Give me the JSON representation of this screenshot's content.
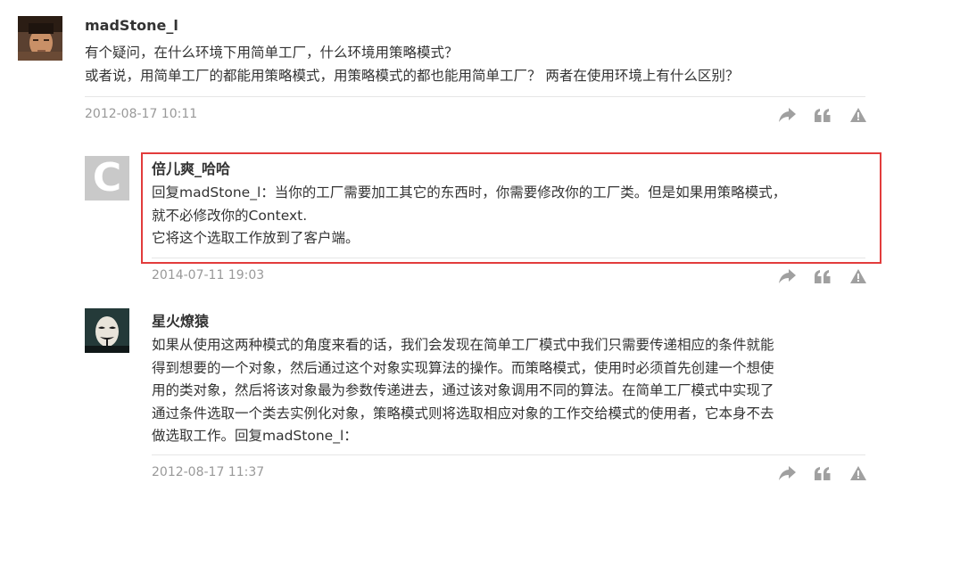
{
  "comments": [
    {
      "author": "madStone_l",
      "lines": [
        "有个疑问，在什么环境下用简单工厂，什么环境用策略模式？",
        "或者说，用简单工厂的都能用策略模式，用策略模式的都也能用简单工厂？ 两者在使用环境上有什么区别？"
      ],
      "time": "2012-08-17 10:11"
    },
    {
      "author": "倍儿爽_哈哈",
      "lines": [
        "回复madStone_l：当你的工厂需要加工其它的东西时，你需要修改你的工厂类。但是如果用策略模式，",
        "就不必修改你的Context.",
        "它将这个选取工作放到了客户端。"
      ],
      "time": "2014-07-11 19:03",
      "avatar_letter": "C"
    },
    {
      "author": "星火燎猿",
      "lines": [
        "如果从使用这两种模式的角度来看的话，我们会发现在简单工厂模式中我们只需要传递相应的条件就能",
        "得到想要的一个对象，然后通过这个对象实现算法的操作。而策略模式，使用时必须首先创建一个想使",
        "用的类对象，然后将该对象最为参数传递进去，通过该对象调用不同的算法。在简单工厂模式中实现了",
        "通过条件选取一个类去实例化对象，策略模式则将选取相应对象的工作交给模式的使用者，它本身不去",
        "做选取工作。回复madStone_l："
      ],
      "time": "2012-08-17 11:37"
    }
  ],
  "actions": [
    "share-icon",
    "quote-icon",
    "report-icon"
  ],
  "colors": {
    "highlight_border": "#e23c3c",
    "icon": "#a0a0a0",
    "meta_text": "#999999",
    "body_text": "#333333",
    "separator": "#e6e6e6"
  }
}
